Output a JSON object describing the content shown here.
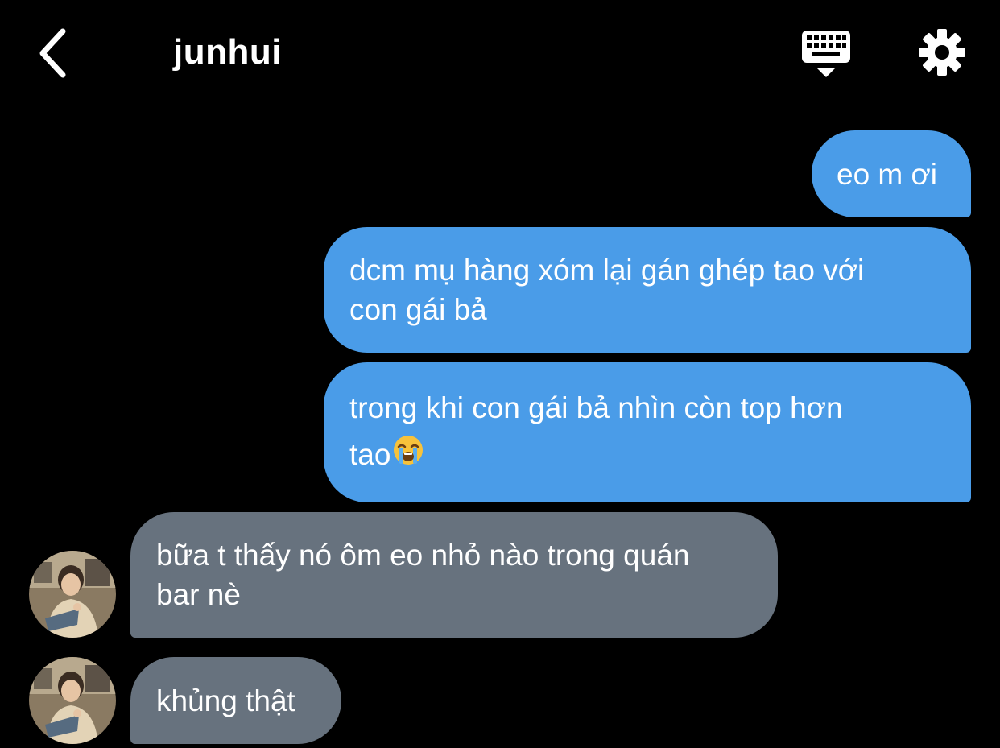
{
  "header": {
    "title": "junhui",
    "back_icon": "chevron-left-icon",
    "keyboard_icon": "keyboard-hide-icon",
    "settings_icon": "gear-icon"
  },
  "colors": {
    "background": "#000000",
    "sent_bubble": "#4a9ce8",
    "received_bubble": "#67727e",
    "text": "#ffffff"
  },
  "messages": [
    {
      "direction": "sent",
      "text": "eo m ơi"
    },
    {
      "direction": "sent",
      "text": "dcm mụ hàng xóm lại gán ghép tao với\ncon gái bả"
    },
    {
      "direction": "sent",
      "text": "trong khi con gái bả nhìn còn top hơn\ntao",
      "emoji": "loudly-crying-face"
    },
    {
      "direction": "received",
      "text": "bữa t thấy nó ôm eo nhỏ nào trong quán\nbar nè",
      "avatar": "contact-avatar"
    },
    {
      "direction": "received",
      "text": "khủng thật",
      "avatar": "contact-avatar"
    }
  ]
}
